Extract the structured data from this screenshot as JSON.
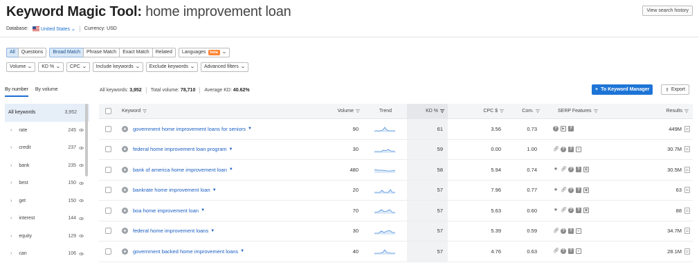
{
  "header": {
    "title": "Keyword Magic Tool:",
    "query": "home improvement loan",
    "database_label": "Database:",
    "database_value": "United States",
    "currency": "Currency: USD",
    "view_history": "View search history"
  },
  "filters": {
    "match_tabs": [
      "All",
      "Questions"
    ],
    "match_types": [
      "Broad Match",
      "Phrase Match",
      "Exact Match",
      "Related"
    ],
    "languages": "Languages",
    "beta": "beta",
    "dropdowns": [
      "Volume",
      "KD %",
      "CPC",
      "Include keywords",
      "Exclude keywords",
      "Advanced filters"
    ]
  },
  "sidebar": {
    "tab_number": "By number",
    "tab_volume": "By volume",
    "all_label": "All keywords",
    "all_count": "3,952",
    "items": [
      {
        "label": "rate",
        "count": "245"
      },
      {
        "label": "credit",
        "count": "237"
      },
      {
        "label": "bank",
        "count": "235"
      },
      {
        "label": "best",
        "count": "150"
      },
      {
        "label": "get",
        "count": "150"
      },
      {
        "label": "interest",
        "count": "144"
      },
      {
        "label": "equity",
        "count": "129"
      },
      {
        "label": "can",
        "count": "106"
      }
    ]
  },
  "stats": {
    "all_keywords_label": "All keywords:",
    "all_keywords": "3,952",
    "total_volume_label": "Total volume:",
    "total_volume": "78,710",
    "avg_kd_label": "Average KD:",
    "avg_kd": "40.62%"
  },
  "actions": {
    "to_keyword_manager": "To Keyword Manager",
    "export": "Export"
  },
  "table": {
    "headers": {
      "keyword": "Keyword",
      "volume": "Volume",
      "trend": "Trend",
      "kd": "KD %",
      "cpc": "CPC $",
      "com": "Com.",
      "serp": "SERP Features",
      "results": "Results"
    },
    "rows": [
      {
        "keyword": "government home improvement loans for seniors",
        "volume": "90",
        "kd": "61",
        "cpc": "3.56",
        "com": "0.73",
        "results": "449M"
      },
      {
        "keyword": "federal home improvement loan program",
        "volume": "30",
        "kd": "59",
        "cpc": "0.00",
        "com": "1.00",
        "results": "30.7M"
      },
      {
        "keyword": "bank of america home improvement loan",
        "volume": "480",
        "kd": "58",
        "cpc": "5.94",
        "com": "0.74",
        "results": "30.5M"
      },
      {
        "keyword": "bankrate home improvement loan",
        "volume": "20",
        "kd": "57",
        "cpc": "7.96",
        "com": "0.77",
        "results": "63"
      },
      {
        "keyword": "boa home improvement loan",
        "volume": "70",
        "kd": "57",
        "cpc": "5.63",
        "com": "0.60",
        "results": "88"
      },
      {
        "keyword": "federal home improvement loans",
        "volume": "30",
        "kd": "57",
        "cpc": "5.39",
        "com": "0.59",
        "results": "34.7M"
      },
      {
        "keyword": "government backed home improvement loans",
        "volume": "40",
        "kd": "57",
        "cpc": "4.76",
        "com": "0.63",
        "results": "28.1M"
      }
    ]
  },
  "colors": {
    "accent": "#1d74d6",
    "beta": "#ff8534",
    "link": "#1a5ec2"
  }
}
